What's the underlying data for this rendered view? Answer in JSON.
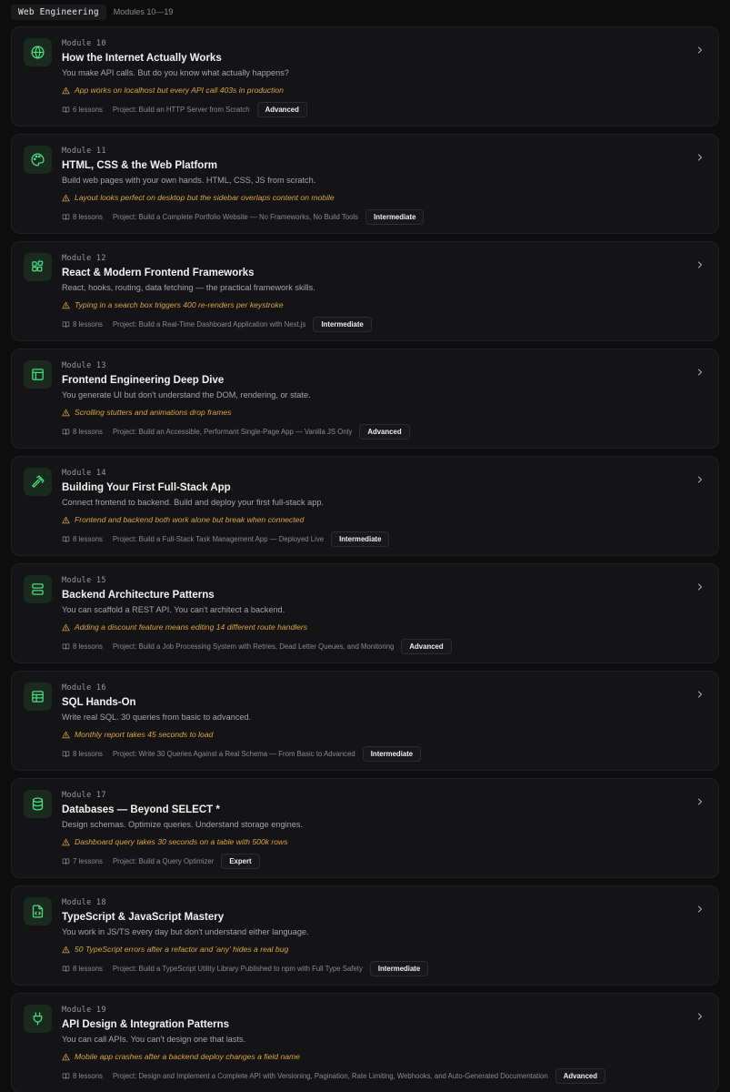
{
  "header": {
    "tag": "Web Engineering",
    "range": "Modules 10—19"
  },
  "colors": {
    "background": "#0d0d0e",
    "card": "#141416",
    "accent_green": "#4ade80",
    "warning_amber": "#d9a53d"
  },
  "modules": [
    {
      "number": "Module 10",
      "title": "How the Internet Actually Works",
      "description": "You make API calls. But do you know what actually happens?",
      "warning": "App works on localhost but every API call 403s in production",
      "lessons": "6 lessons",
      "project": "Project: Build an HTTP Server from Scratch",
      "level": "Advanced",
      "icon": "globe-icon"
    },
    {
      "number": "Module 11",
      "title": "HTML, CSS & the Web Platform",
      "description": "Build web pages with your own hands. HTML, CSS, JS from scratch.",
      "warning": "Layout looks perfect on desktop but the sidebar overlaps content on mobile",
      "lessons": "8 lessons",
      "project": "Project: Build a Complete Portfolio Website — No Frameworks, No Build Tools",
      "level": "Intermediate",
      "icon": "palette-icon"
    },
    {
      "number": "Module 12",
      "title": "React & Modern Frontend Frameworks",
      "description": "React, hooks, routing, data fetching — the practical framework skills.",
      "warning": "Typing in a search box triggers 400 re-renders per keystroke",
      "lessons": "8 lessons",
      "project": "Project: Build a Real-Time Dashboard Application with Next.js",
      "level": "Intermediate",
      "icon": "components-icon"
    },
    {
      "number": "Module 13",
      "title": "Frontend Engineering Deep Dive",
      "description": "You generate UI but don't understand the DOM, rendering, or state.",
      "warning": "Scrolling stutters and animations drop frames",
      "lessons": "8 lessons",
      "project": "Project: Build an Accessible, Performant Single-Page App — Vanilla JS Only",
      "level": "Advanced",
      "icon": "layout-icon"
    },
    {
      "number": "Module 14",
      "title": "Building Your First Full-Stack App",
      "description": "Connect frontend to backend. Build and deploy your first full-stack app.",
      "warning": "Frontend and backend both work alone but break when connected",
      "lessons": "8 lessons",
      "project": "Project: Build a Full-Stack Task Management App — Deployed Live",
      "level": "Intermediate",
      "icon": "hammer-icon"
    },
    {
      "number": "Module 15",
      "title": "Backend Architecture Patterns",
      "description": "You can scaffold a REST API. You can't architect a backend.",
      "warning": "Adding a discount feature means editing 14 different route handlers",
      "lessons": "8 lessons",
      "project": "Project: Build a Job Processing System with Retries, Dead Letter Queues, and Monitoring",
      "level": "Advanced",
      "icon": "server-icon"
    },
    {
      "number": "Module 16",
      "title": "SQL Hands-On",
      "description": "Write real SQL. 30 queries from basic to advanced.",
      "warning": "Monthly report takes 45 seconds to load",
      "lessons": "8 lessons",
      "project": "Project: Write 30 Queries Against a Real Schema — From Basic to Advanced",
      "level": "Intermediate",
      "icon": "table-icon"
    },
    {
      "number": "Module 17",
      "title": "Databases — Beyond SELECT *",
      "description": "Design schemas. Optimize queries. Understand storage engines.",
      "warning": "Dashboard query takes 30 seconds on a table with 500k rows",
      "lessons": "7 lessons",
      "project": "Project: Build a Query Optimizer",
      "level": "Expert",
      "icon": "database-icon"
    },
    {
      "number": "Module 18",
      "title": "TypeScript & JavaScript Mastery",
      "description": "You work in JS/TS every day but don't understand either language.",
      "warning": "50 TypeScript errors after a refactor and 'any' hides a real bug",
      "lessons": "8 lessons",
      "project": "Project: Build a TypeScript Utility Library Published to npm with Full Type Safety",
      "level": "Intermediate",
      "icon": "code-file-icon"
    },
    {
      "number": "Module 19",
      "title": "API Design & Integration Patterns",
      "description": "You can call APIs. You can't design one that lasts.",
      "warning": "Mobile app crashes after a backend deploy changes a field name",
      "lessons": "8 lessons",
      "project": "Project: Design and Implement a Complete API with Versioning, Pagination, Rate Limiting, Webhooks, and Auto-Generated Documentation",
      "level": "Advanced",
      "icon": "plug-icon"
    }
  ]
}
